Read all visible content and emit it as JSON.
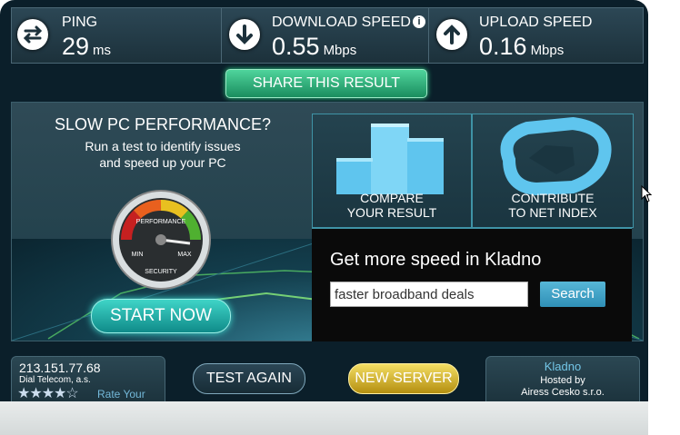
{
  "stats": {
    "ping": {
      "label": "PING",
      "value": "29",
      "unit": "ms",
      "icon": "ping-arrows-icon"
    },
    "download": {
      "label": "DOWNLOAD SPEED",
      "value": "0.55",
      "unit": "Mbps",
      "icon": "download-arrow-icon",
      "info": "i"
    },
    "upload": {
      "label": "UPLOAD SPEED",
      "value": "0.16",
      "unit": "Mbps",
      "icon": "upload-arrow-icon"
    }
  },
  "share_label": "SHARE THIS RESULT",
  "promo": {
    "title": "SLOW PC PERFORMANCE?",
    "subtitle_line1": "Run a test to identify issues",
    "subtitle_line2": "and speed up your PC",
    "gauge": {
      "top_label": "PERFORMANCE",
      "min": "MIN",
      "max": "MAX",
      "bottom_label": "SECURITY"
    },
    "start_label": "START NOW"
  },
  "tiles": [
    {
      "line1": "COMPARE",
      "line2": "YOUR RESULT",
      "icon": "bar-chart-icon"
    },
    {
      "line1": "CONTRIBUTE",
      "line2": "TO NET INDEX",
      "icon": "net-index-icon"
    }
  ],
  "ad": {
    "title": "Get more speed in Kladno",
    "input_value": "faster broadband deals",
    "button_label": "Search"
  },
  "isp": {
    "ip": "213.151.77.68",
    "name": "Dial Telecom, a.s.",
    "stars": "★★★★☆",
    "rate_label": "Rate Your ISP"
  },
  "test_again_label": "TEST AGAIN",
  "new_server_label": "NEW SERVER",
  "server": {
    "city": "Kladno",
    "hosted_line1": "Hosted by",
    "hosted_line2": "Airess Cesko s.r.o."
  },
  "colors": {
    "accent_green": "#2fd487",
    "accent_teal": "#3ee0d4",
    "accent_gold": "#e2c23a",
    "panel": "#1c313b"
  }
}
